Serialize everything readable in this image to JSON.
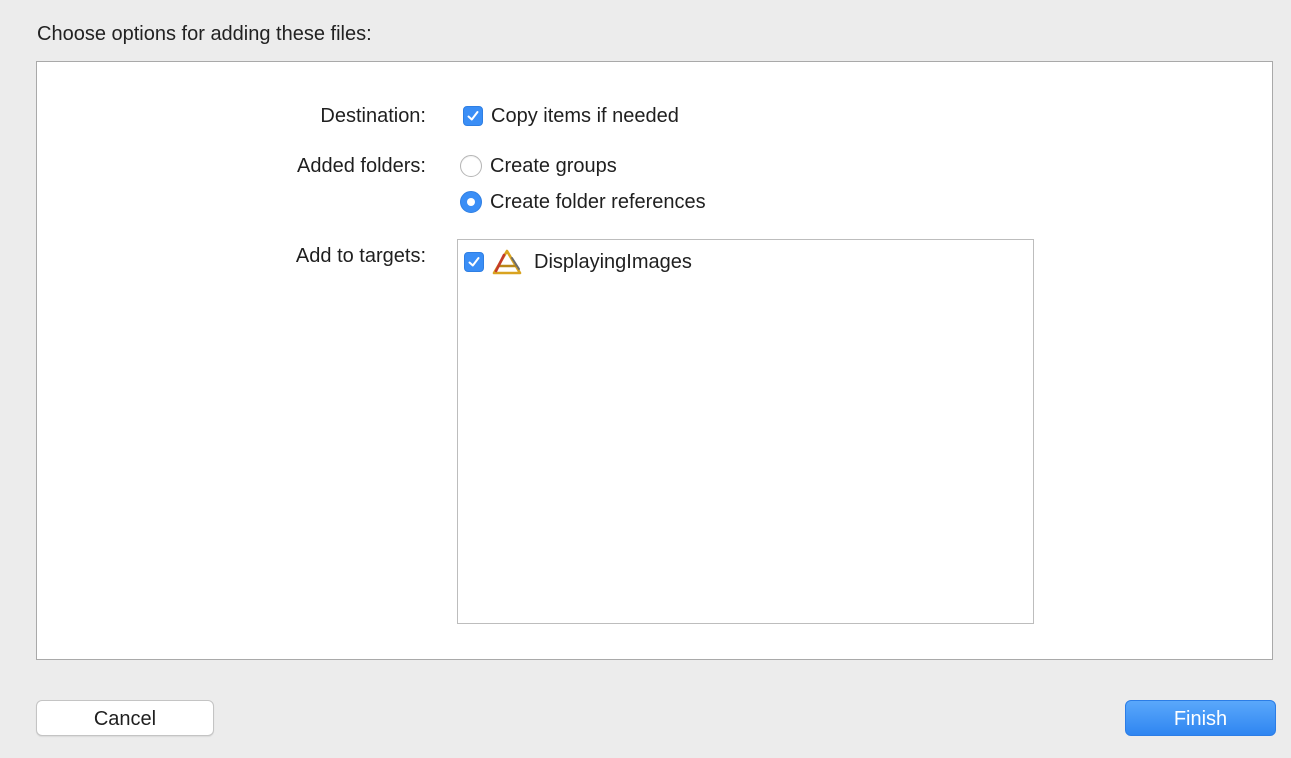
{
  "dialog": {
    "heading": "Choose options for adding these files:"
  },
  "destination": {
    "label": "Destination:",
    "copy_items": {
      "label": "Copy items if needed",
      "checked": true
    }
  },
  "added_folders": {
    "label": "Added folders:",
    "options": [
      {
        "label": "Create groups",
        "selected": false
      },
      {
        "label": "Create folder references",
        "selected": true
      }
    ]
  },
  "targets": {
    "label": "Add to targets:",
    "items": [
      {
        "name": "DisplayingImages",
        "checked": true,
        "icon": "xcode-app-icon"
      }
    ]
  },
  "buttons": {
    "cancel_label": "Cancel",
    "finish_label": "Finish"
  },
  "colors": {
    "accent": "#3a8ef6",
    "background": "#ececec",
    "panel": "#ffffff"
  }
}
